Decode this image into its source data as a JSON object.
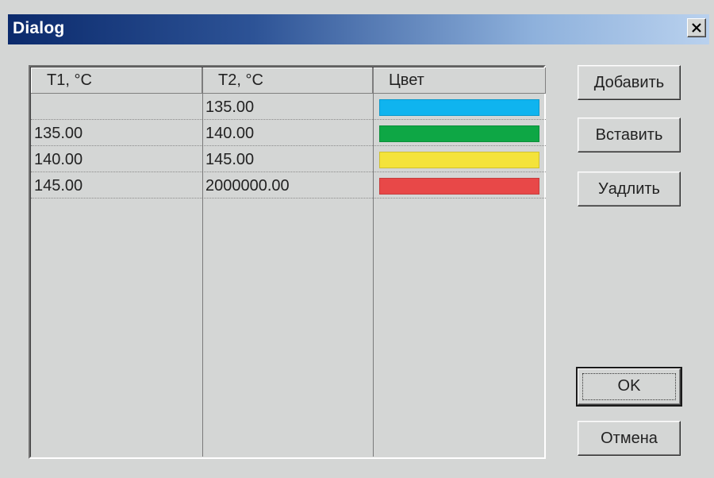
{
  "window": {
    "title": "Dialog"
  },
  "table": {
    "columns": [
      "T1, °C",
      "T2, °C",
      "Цвет"
    ],
    "rows": [
      {
        "t1": "",
        "t2": "135.00",
        "color": "#0fb4ef"
      },
      {
        "t1": "135.00",
        "t2": "140.00",
        "color": "#0ea745"
      },
      {
        "t1": "140.00",
        "t2": "145.00",
        "color": "#f4e33b"
      },
      {
        "t1": "145.00",
        "t2": "2000000.00",
        "color": "#e84848"
      }
    ]
  },
  "buttons": {
    "add": "Добавить",
    "insert": "Вставить",
    "delete": "Уадлить",
    "ok": "OK",
    "cancel": "Отмена"
  },
  "icons": {
    "close": "close-icon"
  }
}
